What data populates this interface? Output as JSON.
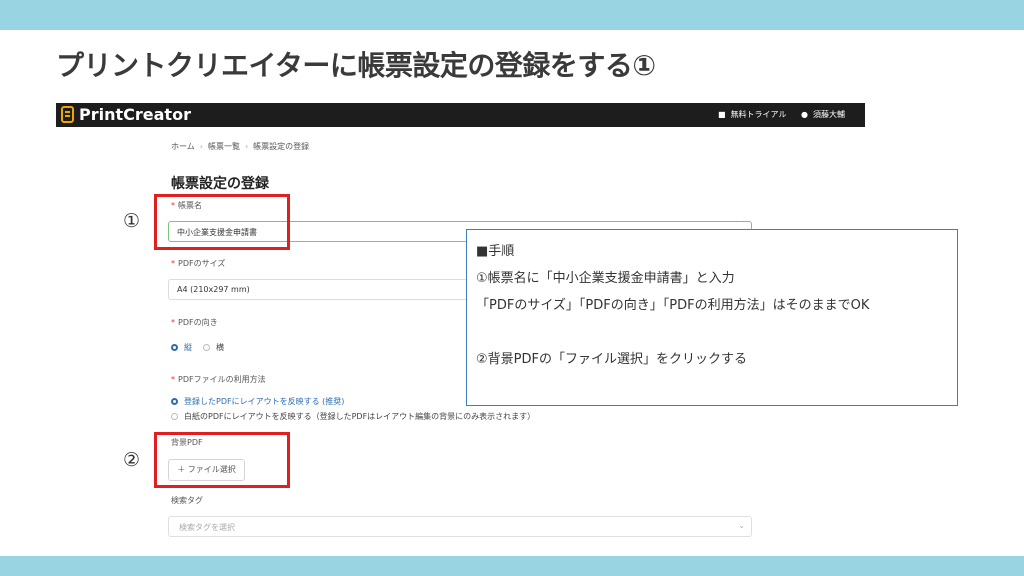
{
  "slide": {
    "title": "プリントクリエイターに帳票設定の登録をする①",
    "marker1": "①",
    "marker2": "②"
  },
  "app": {
    "brand": "PrintCreator",
    "nav": {
      "trial": "無料トライアル",
      "user": "須藤大輔"
    },
    "breadcrumb": [
      "ホーム",
      "帳票一覧",
      "帳票設定の登録"
    ],
    "page_title": "帳票設定の登録",
    "form": {
      "name_label": "帳票名",
      "name_value": "中小企業支援金申請書",
      "pdf_size_label": "PDFのサイズ",
      "pdf_size_value": "A4 (210x297 mm)",
      "orientation_label": "PDFの向き",
      "orientation_options": [
        "縦",
        "横"
      ],
      "usage_label": "PDFファイルの利用方法",
      "usage_options": [
        "登録したPDFにレイアウトを反映する (推奨)",
        "白紙のPDFにレイアウトを反映する（登録したPDFはレイアウト編集の背景にのみ表示されます）"
      ],
      "background_label": "背景PDF",
      "file_button": "＋ ファイル選択",
      "tag_label": "検索タグ",
      "tag_placeholder": "検索タグを選択"
    }
  },
  "note": {
    "lines": [
      "■手順",
      "①帳票名に「中小企業支援金申請書」と入力",
      "「PDFのサイズ」「PDFの向き」「PDFの利用方法」はそのままでOK",
      "",
      "②背景PDFの「ファイル選択」をクリックする"
    ]
  },
  "colors": {
    "band": "#99d4e2",
    "highlight": "#e02020",
    "note_border": "#3b7fc0",
    "appbar": "#1d1d1d",
    "selected": "#2b6cb0"
  },
  "icons": {
    "logo": "printcreator-logo-icon",
    "trial": "gift-icon",
    "user": "user-icon",
    "dropdown": "chevron-down-icon"
  }
}
